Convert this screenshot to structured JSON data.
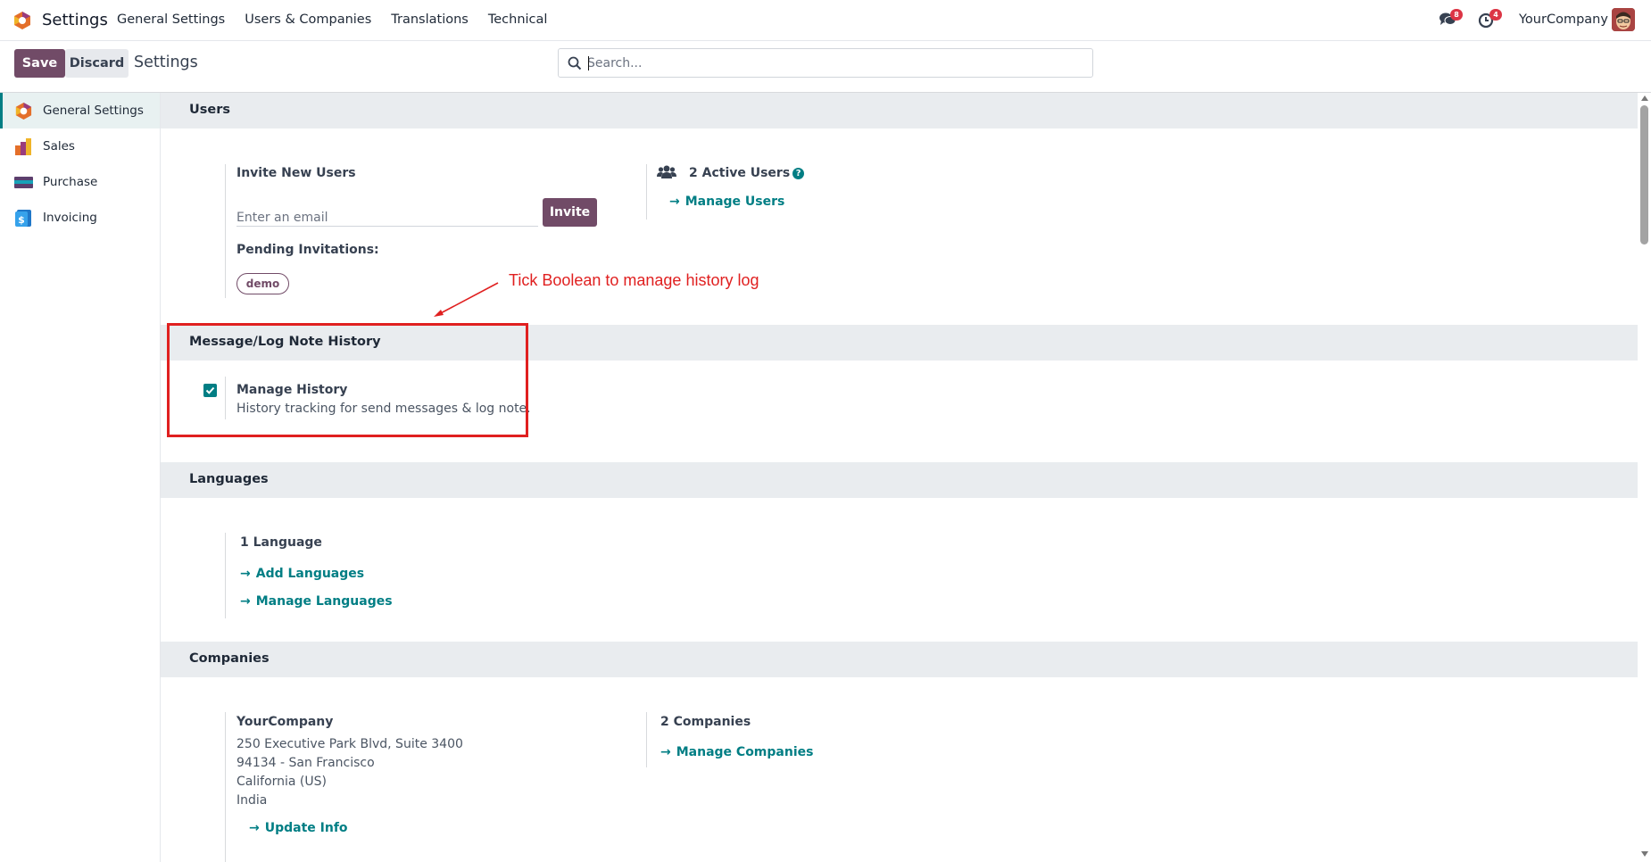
{
  "navbar": {
    "app_name": "Settings",
    "menu": [
      "General Settings",
      "Users & Companies",
      "Translations",
      "Technical"
    ],
    "messages_badge": "8",
    "activities_badge": "4",
    "company": "YourCompany"
  },
  "control_panel": {
    "save_label": "Save",
    "discard_label": "Discard",
    "breadcrumb": "Settings",
    "search_placeholder": "Search..."
  },
  "sidebar": {
    "items": [
      {
        "label": "General Settings",
        "active": true
      },
      {
        "label": "Sales"
      },
      {
        "label": "Purchase"
      },
      {
        "label": "Invoicing"
      }
    ]
  },
  "users": {
    "header": "Users",
    "invite_title": "Invite New Users",
    "email_placeholder": "Enter an email",
    "invite_label": "Invite",
    "pending_label": "Pending Invitations:",
    "pending_invite": "demo",
    "active_users": "2 Active Users",
    "help": "?",
    "manage_users": "Manage Users"
  },
  "history": {
    "header": "Message/Log Note History",
    "title": "Manage History",
    "description": "History tracking for send messages & log note.",
    "checked": true
  },
  "languages": {
    "header": "Languages",
    "count": "1 Language",
    "add": "Add Languages",
    "manage": "Manage Languages"
  },
  "companies": {
    "header": "Companies",
    "name": "YourCompany",
    "address": [
      "250 Executive Park Blvd, Suite 3400",
      "94134 - San Francisco",
      "California (US)",
      "India"
    ],
    "update": "Update Info",
    "count": "2 Companies",
    "manage": "Manage Companies"
  },
  "annotation": {
    "text": "Tick Boolean to manage history log"
  },
  "colors": {
    "primary": "#714b67",
    "accent": "#017e84",
    "annotation": "#e02020"
  }
}
